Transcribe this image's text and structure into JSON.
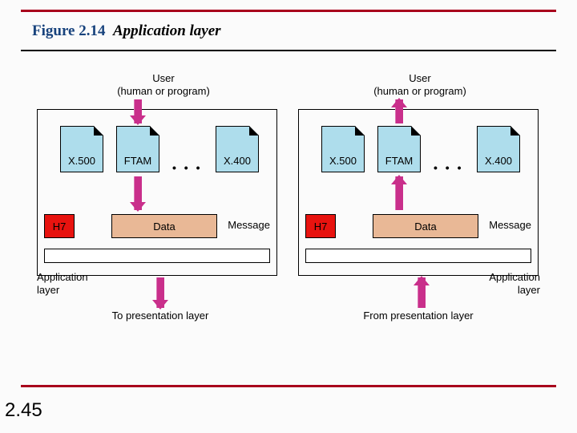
{
  "figure": {
    "number": "Figure 2.14",
    "caption": "Application layer"
  },
  "slide_number": "2.45",
  "user_label_line1": "User",
  "user_label_line2": "(human or program)",
  "protocols": {
    "p1": "X.500",
    "p2": "FTAM",
    "p3": "X.400",
    "ellipsis": "• • •"
  },
  "message": {
    "header": "H7",
    "data": "Data",
    "label": "Message"
  },
  "layer_label_line1": "Application",
  "layer_label_line2": "layer",
  "left_dest": "To presentation layer",
  "right_dest": "From presentation layer"
}
